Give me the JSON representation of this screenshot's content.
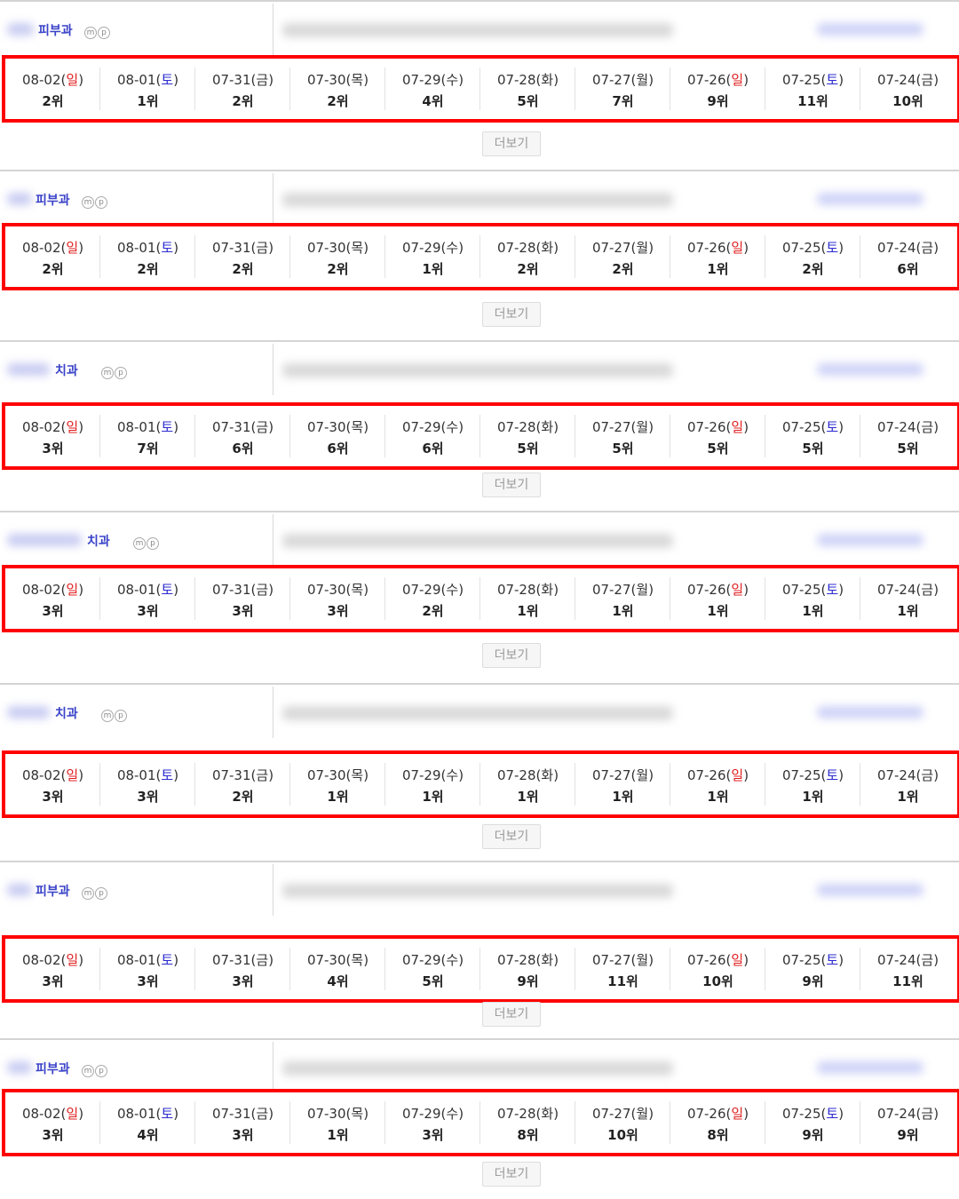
{
  "more_label": "더보기",
  "colors": {
    "highlight_border": "#ff0000",
    "sunday": "#e02020",
    "saturday": "#2b2bd0",
    "category": "#3a43c8"
  },
  "day_type_by_index": [
    "sun",
    "sat",
    "",
    "",
    "",
    "",
    "",
    "sun",
    "sat",
    ""
  ],
  "dates": [
    {
      "md": "08-02",
      "wd": "일"
    },
    {
      "md": "08-01",
      "wd": "토"
    },
    {
      "md": "07-31",
      "wd": "금"
    },
    {
      "md": "07-30",
      "wd": "목"
    },
    {
      "md": "07-29",
      "wd": "수"
    },
    {
      "md": "07-28",
      "wd": "화"
    },
    {
      "md": "07-27",
      "wd": "월"
    },
    {
      "md": "07-26",
      "wd": "일"
    },
    {
      "md": "07-25",
      "wd": "토"
    },
    {
      "md": "07-24",
      "wd": "금"
    }
  ],
  "entries": [
    {
      "category": "피부과",
      "ranks": [
        "2위",
        "1위",
        "2위",
        "2위",
        "4위",
        "5위",
        "7위",
        "9위",
        "11위",
        "10위"
      ]
    },
    {
      "category": "피부과",
      "ranks": [
        "2위",
        "2위",
        "2위",
        "2위",
        "1위",
        "2위",
        "2위",
        "1위",
        "2위",
        "6위"
      ]
    },
    {
      "category": "치과",
      "ranks": [
        "3위",
        "7위",
        "6위",
        "6위",
        "6위",
        "5위",
        "5위",
        "5위",
        "5위",
        "5위"
      ]
    },
    {
      "category": "치과",
      "ranks": [
        "3위",
        "3위",
        "3위",
        "3위",
        "2위",
        "1위",
        "1위",
        "1위",
        "1위",
        "1위"
      ]
    },
    {
      "category": "치과",
      "ranks": [
        "3위",
        "3위",
        "2위",
        "1위",
        "1위",
        "1위",
        "1위",
        "1위",
        "1위",
        "1위"
      ]
    },
    {
      "category": "피부과",
      "ranks": [
        "3위",
        "3위",
        "3위",
        "4위",
        "5위",
        "9위",
        "11위",
        "10위",
        "9위",
        "11위"
      ]
    },
    {
      "category": "피부과",
      "ranks": [
        "3위",
        "4위",
        "3위",
        "1위",
        "3위",
        "8위",
        "10위",
        "8위",
        "9위",
        "9위"
      ]
    }
  ]
}
